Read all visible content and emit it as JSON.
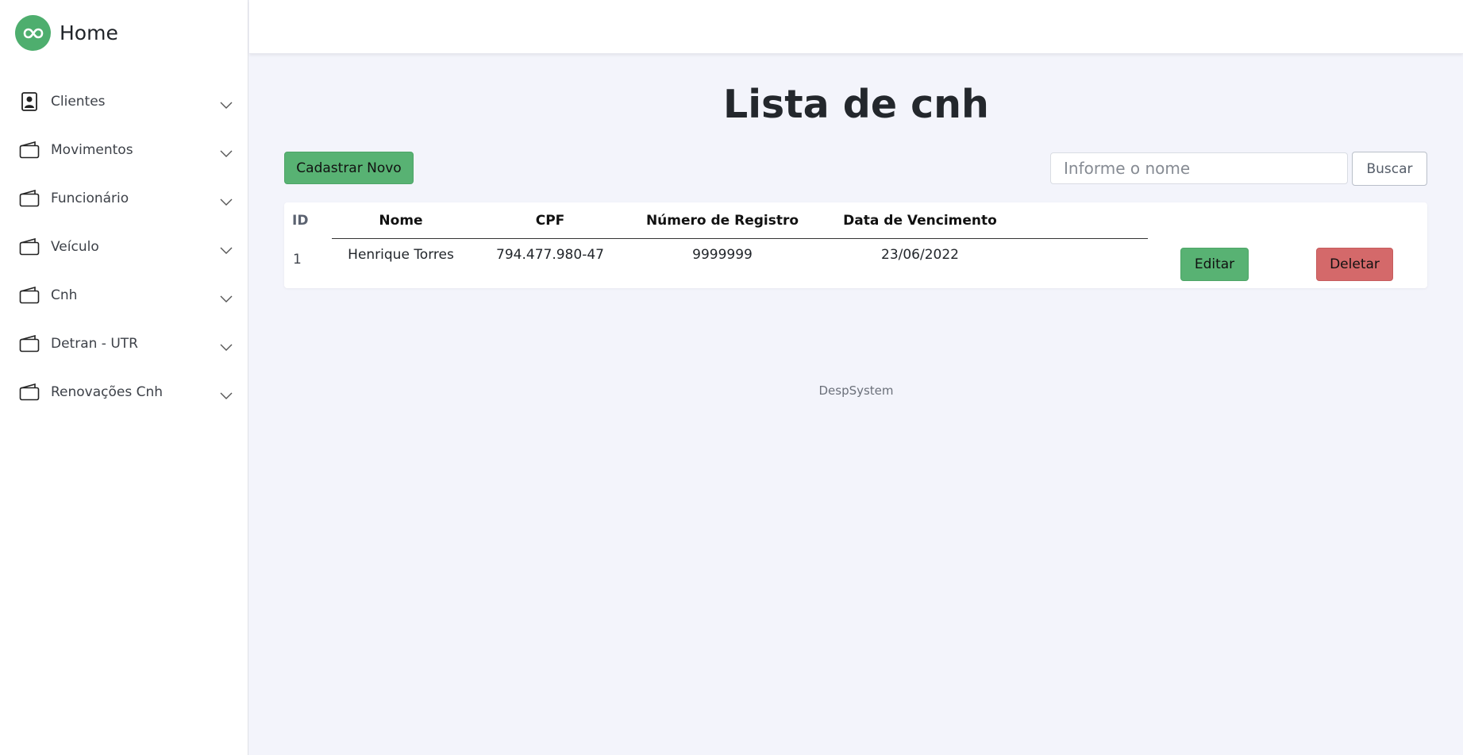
{
  "brand": {
    "title": "Home",
    "logo_icon": "infinity-icon",
    "logo_color": "#4eae6e"
  },
  "sidebar": {
    "items": [
      {
        "label": "Clientes",
        "icon": "contact-card-icon"
      },
      {
        "label": "Movimentos",
        "icon": "wallet-icon"
      },
      {
        "label": "Funcionário",
        "icon": "wallet-icon"
      },
      {
        "label": "Veículo",
        "icon": "wallet-icon"
      },
      {
        "label": "Cnh",
        "icon": "wallet-icon"
      },
      {
        "label": "Detran - UTR",
        "icon": "wallet-icon"
      },
      {
        "label": "Renovações Cnh",
        "icon": "wallet-icon"
      }
    ]
  },
  "main": {
    "title": "Lista de cnh",
    "new_button": "Cadastrar Novo",
    "search": {
      "placeholder": "Informe o nome",
      "value": "",
      "button": "Buscar"
    },
    "table": {
      "headers": [
        "ID",
        "Nome",
        "CPF",
        "Número de Registro",
        "Data de Vencimento"
      ],
      "rows": [
        {
          "id": "1",
          "nome": "Henrique Torres",
          "cpf": "794.477.980-47",
          "registro": "9999999",
          "vencimento": "23/06/2022",
          "edit_label": "Editar",
          "delete_label": "Deletar"
        }
      ]
    },
    "footer": "DespSystem"
  },
  "colors": {
    "success": "#58b273",
    "danger": "#d4696a",
    "page_bg": "#f3f4fb"
  }
}
